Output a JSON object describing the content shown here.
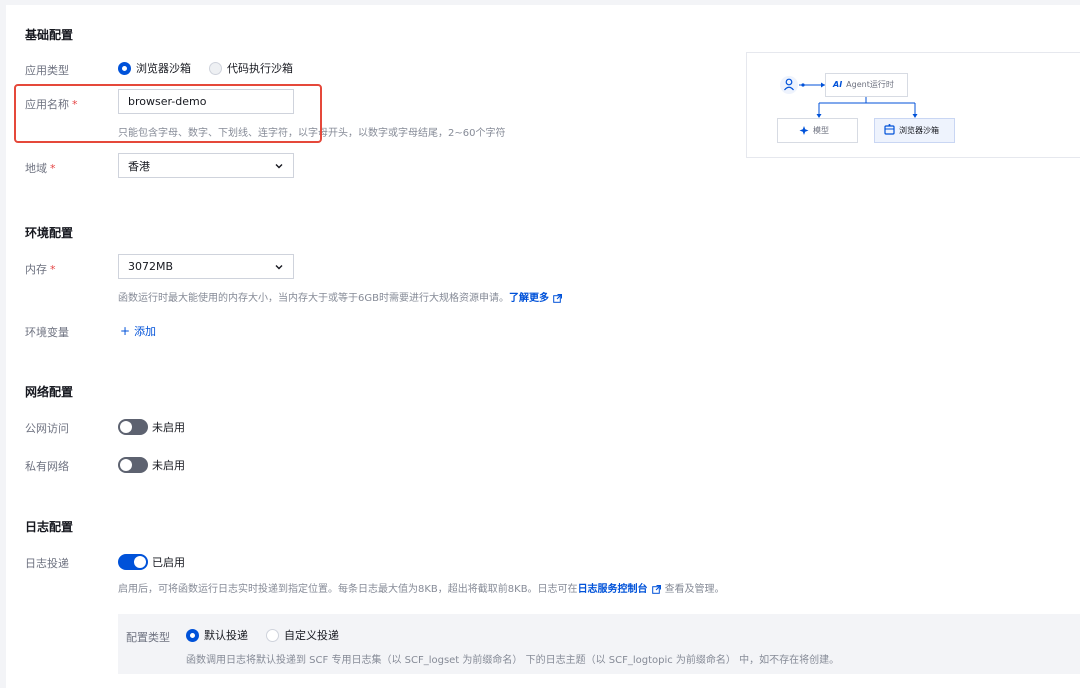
{
  "basic": {
    "title": "基础配置",
    "app_type_label": "应用类型",
    "app_type_options": [
      "浏览器沙箱",
      "代码执行沙箱"
    ],
    "app_name_label": "应用名称",
    "app_name_value": "browser-demo",
    "app_name_hint": "只能包含字母、数字、下划线、连字符，以字母开头，以数字或字母结尾，2~60个字符",
    "region_label": "地域",
    "region_value": "香港",
    "required_mark": "*"
  },
  "diagram": {
    "runtime_label": "Agent运行时",
    "runtime_ai_text": "AI",
    "model_label": "模型",
    "sandbox_label": "浏览器沙箱"
  },
  "env": {
    "title": "环境配置",
    "memory_label": "内存",
    "memory_value": "3072MB",
    "memory_hint": "函数运行时最大能使用的内存大小，当内存大于或等于6GB时需要进行大规格资源申请。",
    "learn_more": "了解更多",
    "env_vars_label": "环境变量",
    "add_label": "添加"
  },
  "network": {
    "title": "网络配置",
    "public_label": "公网访问",
    "public_state": "未启用",
    "private_label": "私有网络",
    "private_state": "未启用"
  },
  "log": {
    "title": "日志配置",
    "delivery_label": "日志投递",
    "delivery_state": "已启用",
    "hint_before": "启用后，可将函数运行日志实时投递到指定位置。每条日志最大值为8KB，超出将截取前8KB。日志可在",
    "hint_link": "日志服务控制台",
    "hint_after": "查看及管理。",
    "config_type_label": "配置类型",
    "config_options": [
      "默认投递",
      "自定义投递"
    ],
    "config_hint": "函数调用日志将默认投递到 SCF 专用日志集（以 SCF_logset 为前缀命名） 下的日志主题（以 SCF_logtopic 为前缀命名） 中，如不存在将创建。"
  },
  "colors": {
    "primary": "#0052d9",
    "required": "#e54545",
    "highlight_border": "#e5483a"
  }
}
